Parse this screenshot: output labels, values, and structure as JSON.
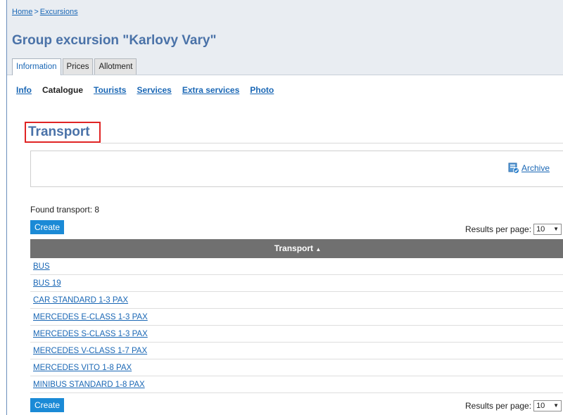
{
  "breadcrumb": {
    "home": "Home",
    "separator": ">",
    "current": "Excursions"
  },
  "page_title": "Group excursion \"Karlovy Vary\"",
  "tabs": [
    {
      "label": "Information",
      "active": true
    },
    {
      "label": "Prices",
      "active": false
    },
    {
      "label": "Allotment",
      "active": false
    }
  ],
  "subnav": {
    "info": "Info",
    "catalogue": "Catalogue",
    "tourists": "Tourists",
    "services": "Services",
    "extra_services": "Extra services",
    "photo": "Photo"
  },
  "section_title": "Transport",
  "archive": {
    "label": "Archive",
    "icon": "archive-icon"
  },
  "found_label": "Found transport: 8",
  "create_label": "Create",
  "results_per_page": {
    "label": "Results per page:",
    "value": "10"
  },
  "table": {
    "header": "Transport",
    "sort_icon": "sort-ascending-icon",
    "rows": [
      "BUS",
      "BUS 19",
      "CAR STANDARD 1-3 PAX",
      "MERCEDES E-CLASS 1-3 PAX",
      "MERCEDES S-CLASS 1-3 PAX",
      "MERCEDES V-CLASS 1-7 PAX",
      "MERCEDES VITO 1-8 PAX",
      "MINIBUS STANDARD 1-8 PAX"
    ]
  },
  "colors": {
    "accent": "#1b8ad6",
    "title": "#4a72a8",
    "link": "#1a67b5",
    "highlight": "#e02424",
    "table_header": "#707070"
  }
}
